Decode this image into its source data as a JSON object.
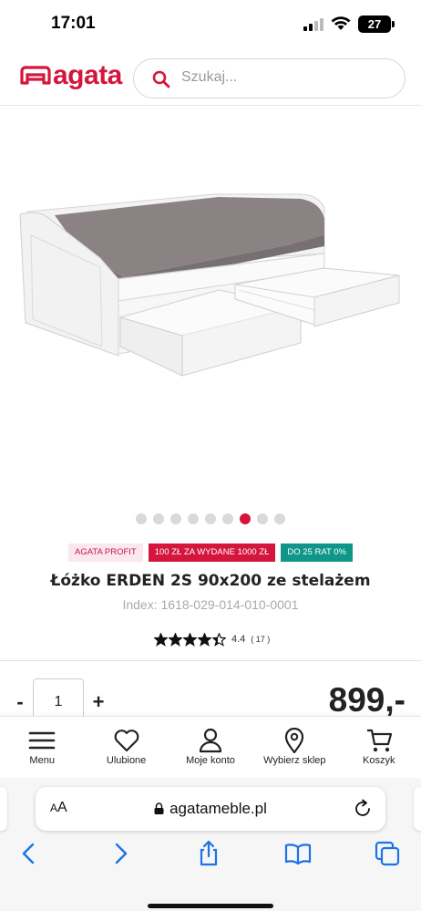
{
  "status_bar": {
    "time": "17:01",
    "battery": "27"
  },
  "header": {
    "logo_text": "agata",
    "search_placeholder": "Szukaj..."
  },
  "gallery": {
    "dot_count": 9,
    "active_index": 6
  },
  "badges": {
    "profit": "AGATA PROFIT",
    "promo": "100 ZŁ ZA WYDANE 1000 ZŁ",
    "installments": "DO 25 RAT 0%"
  },
  "product": {
    "title": "Łóżko ERDEN 2S 90x200 ze stelażem",
    "index": "Index: 1618-029-014-010-0001",
    "rating_value": "4.4",
    "rating_count": "( 17 )",
    "rating_stars": 4.4
  },
  "purchase": {
    "minus": "-",
    "quantity": "1",
    "plus": "+",
    "price": "899,-"
  },
  "bottom_nav": {
    "items": [
      {
        "label": "Menu",
        "icon": "menu-icon"
      },
      {
        "label": "Ulubione",
        "icon": "heart-icon"
      },
      {
        "label": "Moje konto",
        "icon": "user-icon"
      },
      {
        "label": "Wybierz sklep",
        "icon": "location-pin-icon"
      },
      {
        "label": "Koszyk",
        "icon": "cart-icon"
      }
    ]
  },
  "browser": {
    "aa_label_small": "A",
    "aa_label_large": "A",
    "url": "agatameble.pl"
  },
  "colors": {
    "brand": "#d4163d",
    "badge_profit_bg": "#fbe7ee",
    "badge_installments_bg": "#0f9688"
  }
}
